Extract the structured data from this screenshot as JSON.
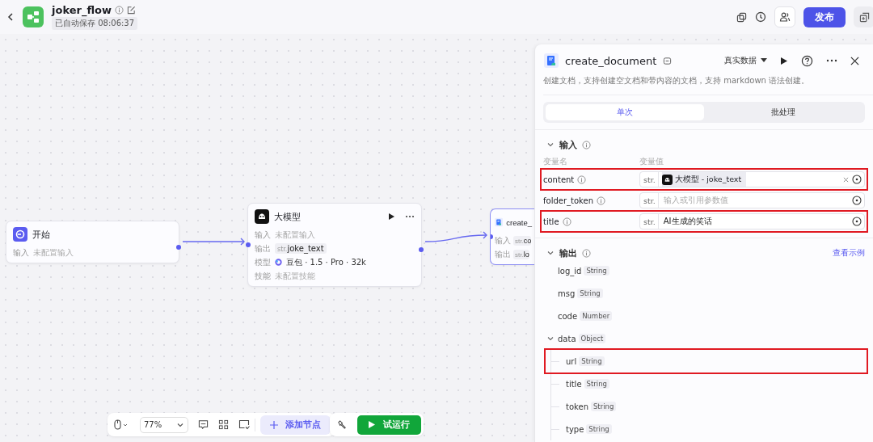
{
  "header": {
    "title": "joker_flow",
    "save_status": "已自动保存 08:06:37",
    "publish_button": "发布"
  },
  "canvas": {
    "nodes": [
      {
        "kind": "start",
        "title": "开始",
        "rows": [
          {
            "label": "输入",
            "kind": "empty",
            "value": "未配置输入"
          }
        ]
      },
      {
        "kind": "llm",
        "title": "大模型",
        "rows": [
          {
            "label": "输入",
            "kind": "empty",
            "value": "未配置输入"
          },
          {
            "label": "输出",
            "kind": "var",
            "type": "str.",
            "value": "joke_text"
          },
          {
            "label": "模型",
            "kind": "model",
            "value": "豆包 · 1.5 · Pro · 32k"
          },
          {
            "label": "技能",
            "kind": "empty",
            "value": "未配置技能"
          }
        ]
      },
      {
        "kind": "plugin",
        "title": "create_",
        "rows": [
          {
            "label": "输入",
            "kind": "var",
            "type": "str.",
            "value": "co"
          },
          {
            "label": "输出",
            "kind": "var",
            "type": "str.",
            "value": "lo"
          }
        ]
      }
    ]
  },
  "toolbar": {
    "zoom": "77%",
    "add_node_button": "添加节点",
    "run_button": "试运行"
  },
  "panel": {
    "title": "create_document",
    "data_mode": "真实数据",
    "description": "创建文档，支持创建空文档和带内容的文档，支持 markdown 语法创建。",
    "tabs": [
      {
        "label": "单次",
        "selected": true
      },
      {
        "label": "批处理",
        "selected": false
      }
    ],
    "input_section": {
      "title": "输入",
      "name_header": "变量名",
      "value_header": "变量值",
      "rows": [
        {
          "name": "content",
          "type": "str.",
          "kind": "ref",
          "reference": "大模型 - joke_text",
          "highlighted": true
        },
        {
          "name": "folder_token",
          "type": "str.",
          "kind": "placeholder",
          "placeholder": "输入或引用参数值",
          "highlighted": false
        },
        {
          "name": "title",
          "type": "str.",
          "kind": "value",
          "value": "AI生成的笑话",
          "highlighted": true
        }
      ]
    },
    "output_section": {
      "title": "输出",
      "example_link": "查看示例",
      "items": [
        {
          "name": "log_id",
          "type": "String",
          "highlighted": false
        },
        {
          "name": "msg",
          "type": "String",
          "highlighted": false
        },
        {
          "name": "code",
          "type": "Number",
          "highlighted": false
        },
        {
          "name": "data",
          "type": "Object",
          "highlighted": false,
          "expanded": true,
          "children": [
            {
              "name": "url",
              "type": "String",
              "highlighted": true
            },
            {
              "name": "title",
              "type": "String",
              "highlighted": false
            },
            {
              "name": "token",
              "type": "String",
              "highlighted": false
            },
            {
              "name": "type",
              "type": "String",
              "highlighted": false
            }
          ]
        }
      ]
    }
  }
}
